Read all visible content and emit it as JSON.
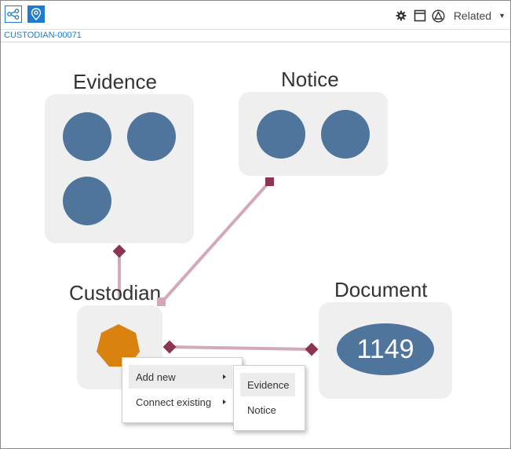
{
  "record_id": "CUSTODIAN-00071",
  "toolbar": {
    "graph_icon": "share-graph-icon",
    "pin_icon": "location-pin-icon",
    "settings_icon": "gear-icon",
    "panel_icon": "panel-icon",
    "shape_icon": "triangle-circle-icon",
    "related_label": "Related"
  },
  "nodes": {
    "evidence": {
      "title": "Evidence"
    },
    "notice": {
      "title": "Notice"
    },
    "custodian": {
      "title": "Custodian"
    },
    "document": {
      "title": "Document",
      "count": "1149"
    }
  },
  "context_menu": {
    "items": [
      {
        "label": "Add new"
      },
      {
        "label": "Connect existing"
      }
    ],
    "submenu": [
      {
        "label": "Evidence"
      },
      {
        "label": "Notice"
      }
    ]
  },
  "colors": {
    "accent": "#1f7bd0",
    "node_fill": "#4f759c",
    "custodian_fill": "#d9820f",
    "edge": "#d3a9b6",
    "edge_marker": "#8b3553",
    "node_box": "#efefef"
  }
}
